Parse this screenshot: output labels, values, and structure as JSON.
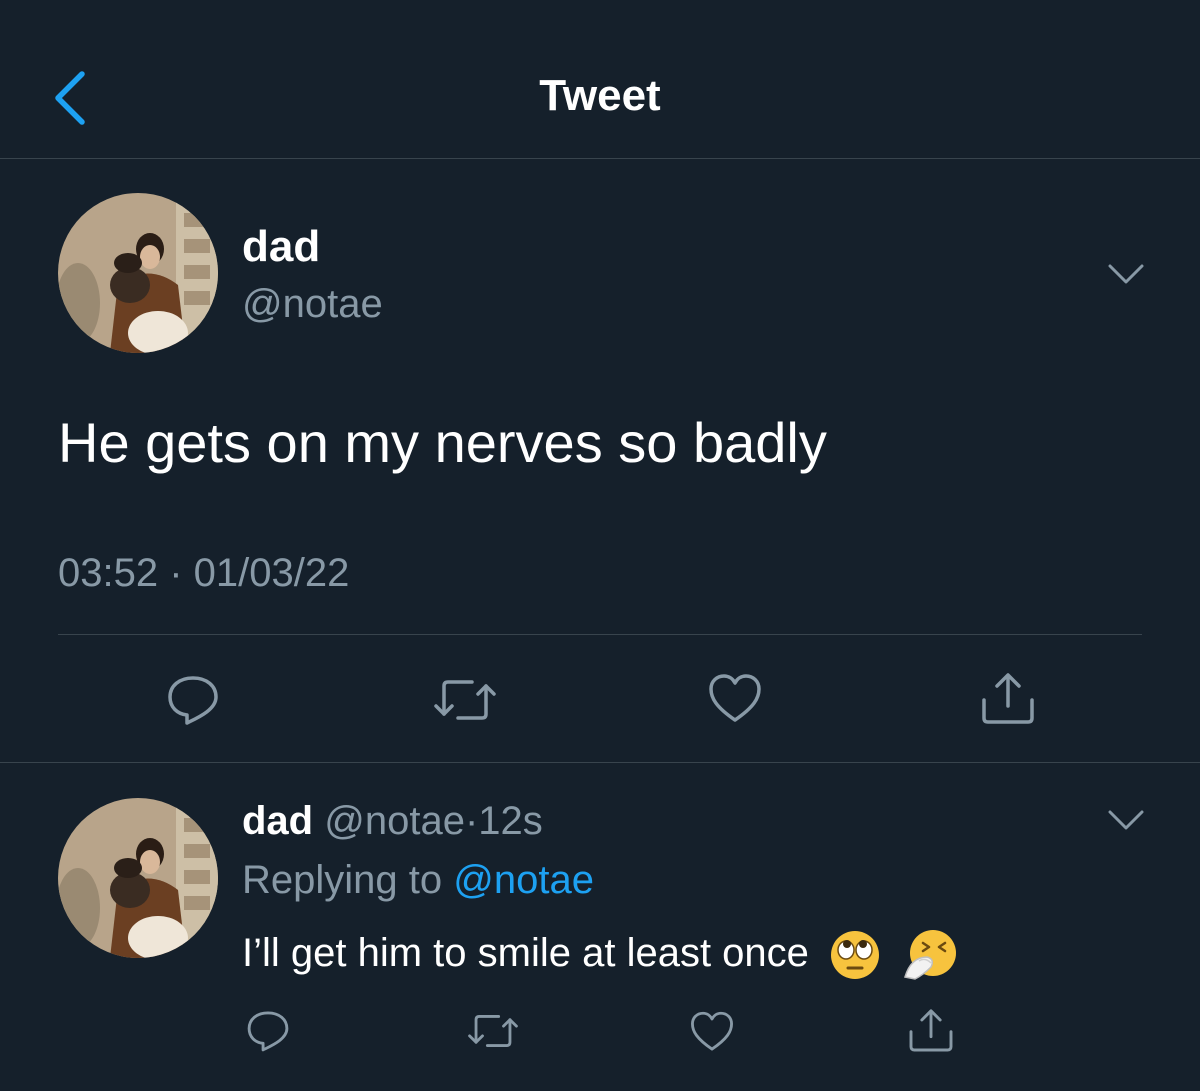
{
  "header": {
    "title": "Tweet",
    "back_icon": "chevron-left-icon"
  },
  "colors": {
    "background": "#15202b",
    "divider": "#38444d",
    "secondary_text": "#8899a6",
    "accent": "#1da1f2"
  },
  "main_tweet": {
    "display_name": "dad",
    "handle": "@notae",
    "text": "He gets on my nerves so badly",
    "timestamp": "03:52 · 01/03/22",
    "actions": [
      "reply-icon",
      "retweet-icon",
      "like-icon",
      "share-icon"
    ]
  },
  "reply_tweet": {
    "display_name": "dad",
    "handle": "@notae",
    "separator": "·",
    "age": "12s",
    "replying_prefix": "Replying to",
    "replying_to": "@notae",
    "text": "I’ll get him to smile at least once",
    "emojis": [
      "face-with-rolling-eyes",
      "sneezing-face"
    ],
    "actions": [
      "reply-icon",
      "retweet-icon",
      "like-icon",
      "share-icon"
    ]
  }
}
